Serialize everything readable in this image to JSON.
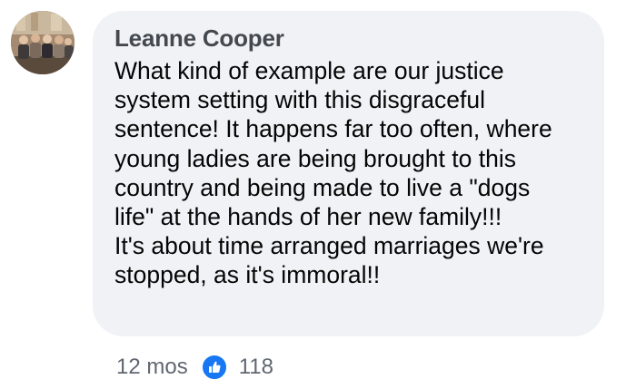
{
  "comment": {
    "author": "Leanne Cooper",
    "lines": [
      "What kind of example are our justice",
      "system setting with this disgraceful",
      "sentence! It happens far too often, where",
      "young ladies are being brought to this",
      "country and being made to live a \"dogs",
      "life\" at the hands of her new family!!!",
      "It's about time arranged marriages we're",
      "stopped, as it's immoral!!"
    ]
  },
  "meta": {
    "timestamp": "12 mos",
    "reaction_icon": "like-icon",
    "reaction_count": "118"
  },
  "colors": {
    "bubble_bg": "#f0f2f5",
    "author": "#444950",
    "text": "#050505",
    "meta": "#606770",
    "like": "#1877f2"
  }
}
